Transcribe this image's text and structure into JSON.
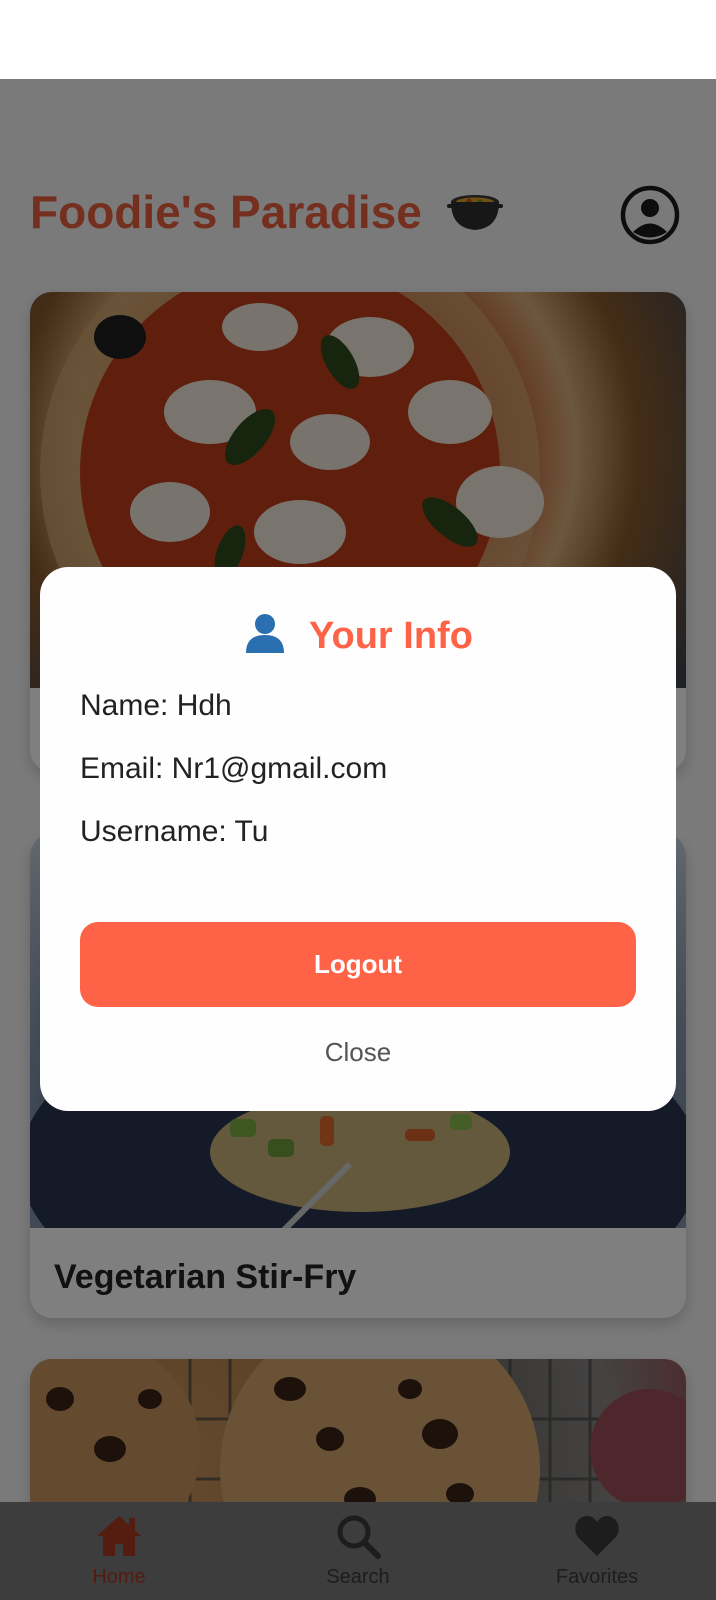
{
  "app": {
    "title": "Foodie's Paradise",
    "title_emoji_icon": "pot-of-food-icon"
  },
  "header": {
    "profile_icon": "profile-icon"
  },
  "recipes": [
    {
      "title": "",
      "image_icon": "pizza-photo"
    },
    {
      "title": "Vegetarian Stir-Fry",
      "image_icon": "stir-fry-photo"
    },
    {
      "title": "",
      "image_icon": "cookies-photo"
    }
  ],
  "modal": {
    "title": "Your Info",
    "title_icon": "user-icon",
    "name": "Name: Hdh",
    "email": "Email: Nr1@gmail.com",
    "username": "Username: Tu",
    "logout_label": "Logout",
    "close_label": "Close"
  },
  "tabs": [
    {
      "label": "Home",
      "icon": "home-icon",
      "active": true
    },
    {
      "label": "Search",
      "icon": "search-icon",
      "active": false
    },
    {
      "label": "Favorites",
      "icon": "heart-icon",
      "active": false
    }
  ],
  "colors": {
    "accent": "#ff6347",
    "title": "#e85e3d",
    "active_tab": "#a83a21",
    "overlay": "rgba(0,0,0,0.5)"
  }
}
